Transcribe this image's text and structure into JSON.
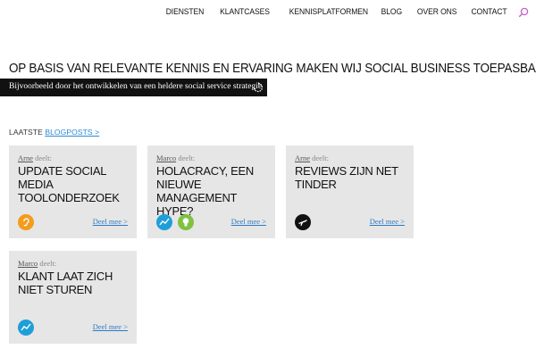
{
  "nav": {
    "items": [
      "DIENSTEN",
      "KLANTCASES",
      "KENNISPLATFORMEN",
      "BLOG",
      "OVER ONS",
      "CONTACT"
    ]
  },
  "hero": {
    "headline": "OP BASIS VAN RELEVANTE KENNIS EN ERVARING MAKEN WIJ SOCIAL BUSINESS TOEPASBAAR",
    "subline": "Bijvoorbeeld door het ontwikkelen van een heldere social service strategie"
  },
  "blog": {
    "label": "LAATSTE",
    "link": "BLOGPOSTS >",
    "shares_word": "deelt:",
    "share_label": "Deel mee >",
    "cards": [
      {
        "author": "Arne",
        "title": "UPDATE SOCIAL MEDIA TOOLONDERZOEK",
        "icons": [
          "ear-icon"
        ],
        "colors": [
          "#f39c1e"
        ]
      },
      {
        "author": "Marco",
        "title": "HOLACRACY, EEN NIEUWE MANAGEMENT HYPE?",
        "icons": [
          "trend-icon",
          "lightbulb-icon"
        ],
        "colors": [
          "#1f9fd8",
          "#7fc242"
        ]
      },
      {
        "author": "Arne",
        "title": "REVIEWS ZIJN NET TINDER",
        "icons": [
          "airplane-icon"
        ],
        "colors": [
          "#111111"
        ]
      },
      {
        "author": "Marco",
        "title": "KLANT LAAT ZICH NIET STUREN",
        "icons": [
          "trend-icon"
        ],
        "colors": [
          "#1f9fd8"
        ]
      }
    ]
  },
  "accent": {
    "link": "#2a8bd6",
    "search": "#c85ec7"
  }
}
